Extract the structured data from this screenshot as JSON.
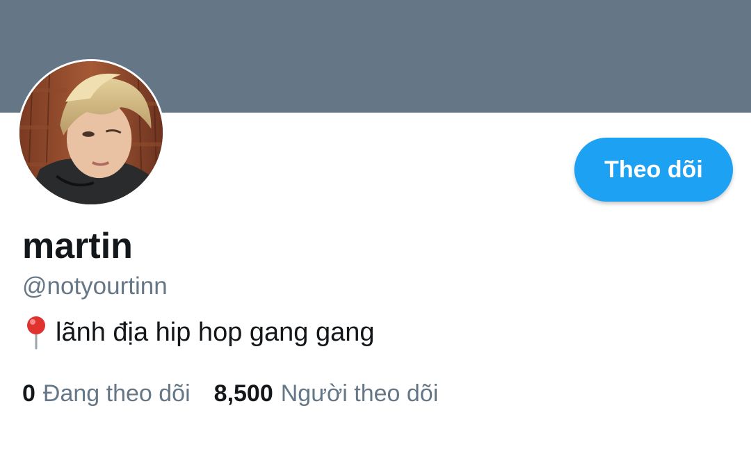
{
  "profile": {
    "display_name": "martin",
    "handle": "@notyourtinn",
    "bio": "lãnh địa hip hop gang gang",
    "bio_icon": "round-pushpin-icon",
    "avatar_icon": "profile-photo"
  },
  "actions": {
    "follow_label": "Theo dõi"
  },
  "stats": {
    "following_count": "0",
    "following_label": "Đang theo dõi",
    "followers_count": "8,500",
    "followers_label": "Người theo dõi"
  },
  "colors": {
    "banner": "#657786",
    "accent": "#1da1f2",
    "primary_text": "#14171a",
    "secondary_text": "#657786"
  }
}
